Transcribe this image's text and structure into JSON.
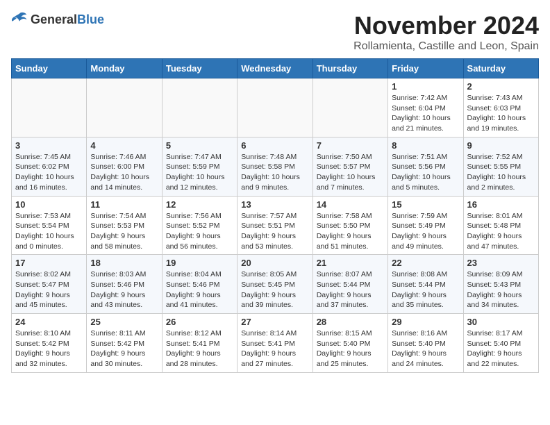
{
  "header": {
    "logo_general": "General",
    "logo_blue": "Blue",
    "month_title": "November 2024",
    "subtitle": "Rollamienta, Castille and Leon, Spain"
  },
  "weekdays": [
    "Sunday",
    "Monday",
    "Tuesday",
    "Wednesday",
    "Thursday",
    "Friday",
    "Saturday"
  ],
  "weeks": [
    [
      {
        "day": "",
        "info": ""
      },
      {
        "day": "",
        "info": ""
      },
      {
        "day": "",
        "info": ""
      },
      {
        "day": "",
        "info": ""
      },
      {
        "day": "",
        "info": ""
      },
      {
        "day": "1",
        "info": "Sunrise: 7:42 AM\nSunset: 6:04 PM\nDaylight: 10 hours and 21 minutes."
      },
      {
        "day": "2",
        "info": "Sunrise: 7:43 AM\nSunset: 6:03 PM\nDaylight: 10 hours and 19 minutes."
      }
    ],
    [
      {
        "day": "3",
        "info": "Sunrise: 7:45 AM\nSunset: 6:02 PM\nDaylight: 10 hours and 16 minutes."
      },
      {
        "day": "4",
        "info": "Sunrise: 7:46 AM\nSunset: 6:00 PM\nDaylight: 10 hours and 14 minutes."
      },
      {
        "day": "5",
        "info": "Sunrise: 7:47 AM\nSunset: 5:59 PM\nDaylight: 10 hours and 12 minutes."
      },
      {
        "day": "6",
        "info": "Sunrise: 7:48 AM\nSunset: 5:58 PM\nDaylight: 10 hours and 9 minutes."
      },
      {
        "day": "7",
        "info": "Sunrise: 7:50 AM\nSunset: 5:57 PM\nDaylight: 10 hours and 7 minutes."
      },
      {
        "day": "8",
        "info": "Sunrise: 7:51 AM\nSunset: 5:56 PM\nDaylight: 10 hours and 5 minutes."
      },
      {
        "day": "9",
        "info": "Sunrise: 7:52 AM\nSunset: 5:55 PM\nDaylight: 10 hours and 2 minutes."
      }
    ],
    [
      {
        "day": "10",
        "info": "Sunrise: 7:53 AM\nSunset: 5:54 PM\nDaylight: 10 hours and 0 minutes."
      },
      {
        "day": "11",
        "info": "Sunrise: 7:54 AM\nSunset: 5:53 PM\nDaylight: 9 hours and 58 minutes."
      },
      {
        "day": "12",
        "info": "Sunrise: 7:56 AM\nSunset: 5:52 PM\nDaylight: 9 hours and 56 minutes."
      },
      {
        "day": "13",
        "info": "Sunrise: 7:57 AM\nSunset: 5:51 PM\nDaylight: 9 hours and 53 minutes."
      },
      {
        "day": "14",
        "info": "Sunrise: 7:58 AM\nSunset: 5:50 PM\nDaylight: 9 hours and 51 minutes."
      },
      {
        "day": "15",
        "info": "Sunrise: 7:59 AM\nSunset: 5:49 PM\nDaylight: 9 hours and 49 minutes."
      },
      {
        "day": "16",
        "info": "Sunrise: 8:01 AM\nSunset: 5:48 PM\nDaylight: 9 hours and 47 minutes."
      }
    ],
    [
      {
        "day": "17",
        "info": "Sunrise: 8:02 AM\nSunset: 5:47 PM\nDaylight: 9 hours and 45 minutes."
      },
      {
        "day": "18",
        "info": "Sunrise: 8:03 AM\nSunset: 5:46 PM\nDaylight: 9 hours and 43 minutes."
      },
      {
        "day": "19",
        "info": "Sunrise: 8:04 AM\nSunset: 5:46 PM\nDaylight: 9 hours and 41 minutes."
      },
      {
        "day": "20",
        "info": "Sunrise: 8:05 AM\nSunset: 5:45 PM\nDaylight: 9 hours and 39 minutes."
      },
      {
        "day": "21",
        "info": "Sunrise: 8:07 AM\nSunset: 5:44 PM\nDaylight: 9 hours and 37 minutes."
      },
      {
        "day": "22",
        "info": "Sunrise: 8:08 AM\nSunset: 5:44 PM\nDaylight: 9 hours and 35 minutes."
      },
      {
        "day": "23",
        "info": "Sunrise: 8:09 AM\nSunset: 5:43 PM\nDaylight: 9 hours and 34 minutes."
      }
    ],
    [
      {
        "day": "24",
        "info": "Sunrise: 8:10 AM\nSunset: 5:42 PM\nDaylight: 9 hours and 32 minutes."
      },
      {
        "day": "25",
        "info": "Sunrise: 8:11 AM\nSunset: 5:42 PM\nDaylight: 9 hours and 30 minutes."
      },
      {
        "day": "26",
        "info": "Sunrise: 8:12 AM\nSunset: 5:41 PM\nDaylight: 9 hours and 28 minutes."
      },
      {
        "day": "27",
        "info": "Sunrise: 8:14 AM\nSunset: 5:41 PM\nDaylight: 9 hours and 27 minutes."
      },
      {
        "day": "28",
        "info": "Sunrise: 8:15 AM\nSunset: 5:40 PM\nDaylight: 9 hours and 25 minutes."
      },
      {
        "day": "29",
        "info": "Sunrise: 8:16 AM\nSunset: 5:40 PM\nDaylight: 9 hours and 24 minutes."
      },
      {
        "day": "30",
        "info": "Sunrise: 8:17 AM\nSunset: 5:40 PM\nDaylight: 9 hours and 22 minutes."
      }
    ]
  ]
}
